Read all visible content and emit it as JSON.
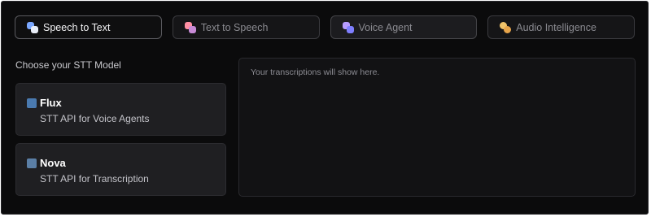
{
  "tabs": [
    {
      "label": "Speech to Text",
      "icon": "speech-to-text-icon",
      "colors": [
        "#7aa7ff",
        "#ffffff"
      ]
    },
    {
      "label": "Text to Speech",
      "icon": "text-to-speech-icon",
      "colors": [
        "#ff8fa3",
        "#c78ad6"
      ]
    },
    {
      "label": "Voice Agent",
      "icon": "voice-agent-icon",
      "colors": [
        "#b79cff",
        "#7f7fff"
      ]
    },
    {
      "label": "Audio Intelligence",
      "icon": "brain-icon",
      "colors": [
        "#f0c36a",
        "#e7a54b"
      ]
    }
  ],
  "left": {
    "title": "Choose your STT Model",
    "models": [
      {
        "name": "Flux",
        "desc": "STT API for Voice Agents",
        "icon_color": "#4a7ab0"
      },
      {
        "name": "Nova",
        "desc": "STT API for Transcription",
        "icon_color": "#5b7fa6"
      }
    ]
  },
  "output": {
    "placeholder": "Your transcriptions will show here."
  }
}
